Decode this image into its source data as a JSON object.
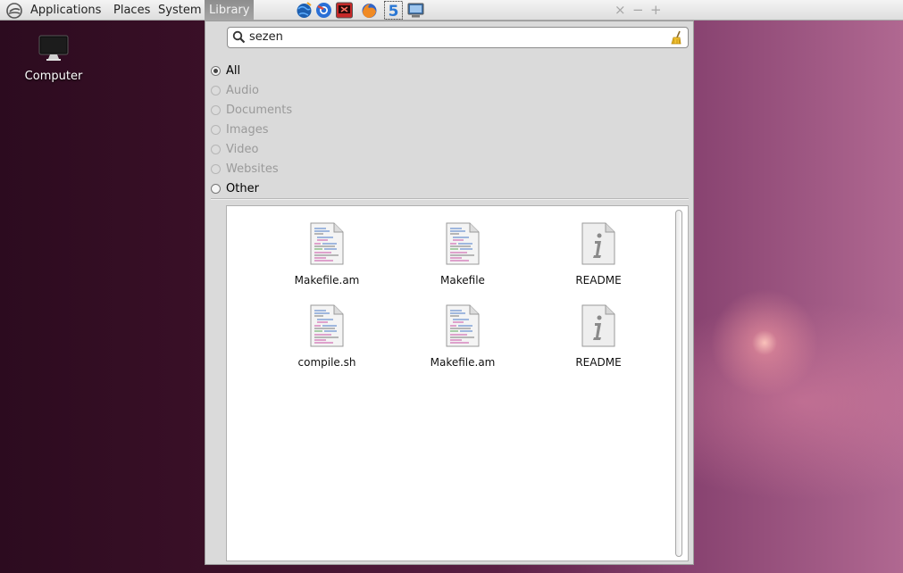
{
  "topbar": {
    "menus": [
      "Applications",
      "Places",
      "System",
      "Library"
    ],
    "launchers": [
      "globe-icon",
      "browser-icon",
      "media-icon",
      "firefox-icon",
      "five-icon",
      "monitor-icon"
    ],
    "window_controls": [
      "×",
      "−",
      "+"
    ]
  },
  "desktop": {
    "icons": [
      {
        "label": "Computer",
        "icon": "computer-icon"
      }
    ]
  },
  "library": {
    "search": {
      "value": "sezen",
      "placeholder": ""
    },
    "filters": [
      {
        "label": "All",
        "checked": true,
        "enabled": true
      },
      {
        "label": "Audio",
        "checked": false,
        "enabled": false
      },
      {
        "label": "Documents",
        "checked": false,
        "enabled": false
      },
      {
        "label": "Images",
        "checked": false,
        "enabled": false
      },
      {
        "label": "Video",
        "checked": false,
        "enabled": false
      },
      {
        "label": "Websites",
        "checked": false,
        "enabled": false
      },
      {
        "label": "Other",
        "checked": false,
        "enabled": true
      }
    ],
    "results": [
      {
        "name": "Makefile.am",
        "icon": "text-file-icon"
      },
      {
        "name": "Makefile",
        "icon": "text-file-icon"
      },
      {
        "name": "README",
        "icon": "info-file-icon"
      },
      {
        "name": "compile.sh",
        "icon": "text-file-icon"
      },
      {
        "name": "Makefile.am",
        "icon": "text-file-icon"
      },
      {
        "name": "README",
        "icon": "info-file-icon"
      }
    ]
  },
  "colors": {
    "accent_menu_active": "#9a9a9a",
    "panel_bg": "#dadada"
  }
}
